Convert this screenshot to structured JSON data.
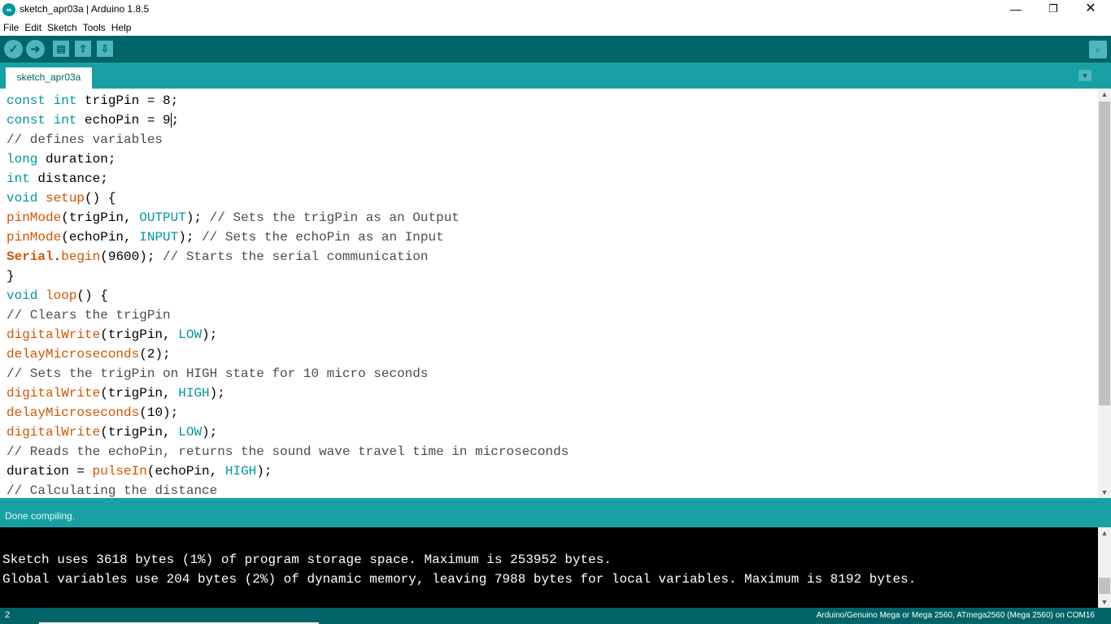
{
  "window": {
    "title": "sketch_apr03a | Arduino 1.8.5",
    "app_icon_text": "∞",
    "minimize_glyph": "—",
    "maximize_glyph": "❐",
    "close_glyph": "✕"
  },
  "menu": [
    "File",
    "Edit",
    "Sketch",
    "Tools",
    "Help"
  ],
  "toolbar": {
    "verify_glyph": "✓",
    "upload_glyph": "➜",
    "new_glyph": "▤",
    "open_glyph": "⇧",
    "save_glyph": "⇩",
    "serial_monitor_glyph": "⌕"
  },
  "tabs": {
    "active": "sketch_apr03a",
    "menu_glyph": "▼"
  },
  "editor": {
    "lines": [
      [
        [
          "kw",
          "const"
        ],
        [
          "t",
          " "
        ],
        [
          "kw",
          "int"
        ],
        [
          "t",
          " trigPin = 8;"
        ]
      ],
      [
        [
          "kw",
          "const"
        ],
        [
          "t",
          " "
        ],
        [
          "kw",
          "int"
        ],
        [
          "t",
          " echoPin = 9"
        ],
        [
          "caret",
          ""
        ],
        [
          "t",
          ";"
        ]
      ],
      [
        [
          "cmt",
          "// defines variables"
        ]
      ],
      [
        [
          "kw",
          "long"
        ],
        [
          "t",
          " duration;"
        ]
      ],
      [
        [
          "kw",
          "int"
        ],
        [
          "t",
          " distance;"
        ]
      ],
      [
        [
          "kw",
          "void"
        ],
        [
          "t",
          " "
        ],
        [
          "fn",
          "setup"
        ],
        [
          "t",
          "() {"
        ]
      ],
      [
        [
          "fn",
          "pinMode"
        ],
        [
          "t",
          "(trigPin, "
        ],
        [
          "const",
          "OUTPUT"
        ],
        [
          "t",
          "); "
        ],
        [
          "cmt",
          "// Sets the trigPin as an Output"
        ]
      ],
      [
        [
          "fn",
          "pinMode"
        ],
        [
          "t",
          "(echoPin, "
        ],
        [
          "const",
          "INPUT"
        ],
        [
          "t",
          "); "
        ],
        [
          "cmt",
          "// Sets the echoPin as an Input"
        ]
      ],
      [
        [
          "serial",
          "Serial"
        ],
        [
          "t",
          "."
        ],
        [
          "fn",
          "begin"
        ],
        [
          "t",
          "(9600); "
        ],
        [
          "cmt",
          "// Starts the serial communication"
        ]
      ],
      [
        [
          "t",
          "}"
        ]
      ],
      [
        [
          "kw",
          "void"
        ],
        [
          "t",
          " "
        ],
        [
          "fn",
          "loop"
        ],
        [
          "t",
          "() {"
        ]
      ],
      [
        [
          "cmt",
          "// Clears the trigPin"
        ]
      ],
      [
        [
          "fn",
          "digitalWrite"
        ],
        [
          "t",
          "(trigPin, "
        ],
        [
          "const",
          "LOW"
        ],
        [
          "t",
          ");"
        ]
      ],
      [
        [
          "fn",
          "delayMicroseconds"
        ],
        [
          "t",
          "(2);"
        ]
      ],
      [
        [
          "cmt",
          "// Sets the trigPin on HIGH state for 10 micro seconds"
        ]
      ],
      [
        [
          "fn",
          "digitalWrite"
        ],
        [
          "t",
          "(trigPin, "
        ],
        [
          "const",
          "HIGH"
        ],
        [
          "t",
          ");"
        ]
      ],
      [
        [
          "fn",
          "delayMicroseconds"
        ],
        [
          "t",
          "(10);"
        ]
      ],
      [
        [
          "fn",
          "digitalWrite"
        ],
        [
          "t",
          "(trigPin, "
        ],
        [
          "const",
          "LOW"
        ],
        [
          "t",
          ");"
        ]
      ],
      [
        [
          "cmt",
          "// Reads the echoPin, returns the sound wave travel time in microseconds"
        ]
      ],
      [
        [
          "t",
          "duration = "
        ],
        [
          "fn",
          "pulseIn"
        ],
        [
          "t",
          "(echoPin, "
        ],
        [
          "const",
          "HIGH"
        ],
        [
          "t",
          ");"
        ]
      ],
      [
        [
          "cmt",
          "// Calculating the distance"
        ]
      ]
    ],
    "scroll_up_glyph": "▲",
    "scroll_down_glyph": "▼"
  },
  "status": {
    "message": "Done compiling."
  },
  "console": {
    "lines": [
      "Sketch uses 3618 bytes (1%) of program storage space. Maximum is 253952 bytes.",
      "Global variables use 204 bytes (2%) of dynamic memory, leaving 7988 bytes for local variables. Maximum is 8192 bytes."
    ],
    "scroll_up_glyph": "▲",
    "scroll_down_glyph": "▼"
  },
  "footer": {
    "line_number": "2",
    "board": "Arduino/Genuino Mega or Mega 2560, ATmega2560 (Mega 2560) on COM16"
  },
  "colors": {
    "toolbar": "#006468",
    "tabbar": "#17a1a5",
    "keyword": "#00979c",
    "function": "#d35400",
    "comment": "#434f54"
  }
}
